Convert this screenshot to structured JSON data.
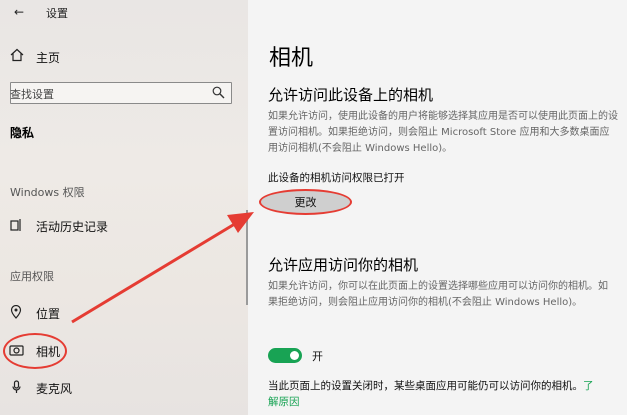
{
  "window": {
    "title": "设置"
  },
  "colors": {
    "accent": "#18a354",
    "annotation": "#e53c33"
  },
  "sidebar": {
    "home_label": "主页",
    "search_placeholder": "查找设置",
    "section_title": "隐私",
    "group_windows": "Windows 权限",
    "activity_history": "活动历史记录",
    "group_app": "应用权限",
    "items": [
      {
        "label": "位置",
        "icon": "location-pin-icon"
      },
      {
        "label": "相机",
        "icon": "camera-icon",
        "selected": true
      },
      {
        "label": "麦克风",
        "icon": "microphone-icon"
      }
    ]
  },
  "main": {
    "title": "相机",
    "section1": {
      "title": "允许访问此设备上的相机",
      "description": "如果允许访问，使用此设备的用户将能够选择其应用是否可以使用此页面上的设置访问相机。如果拒绝访问，则会阻止 Microsoft Store 应用和大多数桌面应用访问相机(不会阻止 Windows Hello)。",
      "status": "此设备的相机访问权限已打开",
      "change_button": "更改"
    },
    "section2": {
      "title": "允许应用访问你的相机",
      "description": "如果允许访问，你可以在此页面上的设置选择哪些应用可以访问你的相机。如果拒绝访问，则会阻止应用访问你的相机(不会阻止 Windows Hello)。",
      "toggle_state": "on",
      "toggle_label": "开",
      "note": "当此页面上的设置关闭时，某些桌面应用可能仍可以访问你的相机。",
      "note_link_part1": "了",
      "note_link_part2": "解原因"
    }
  }
}
